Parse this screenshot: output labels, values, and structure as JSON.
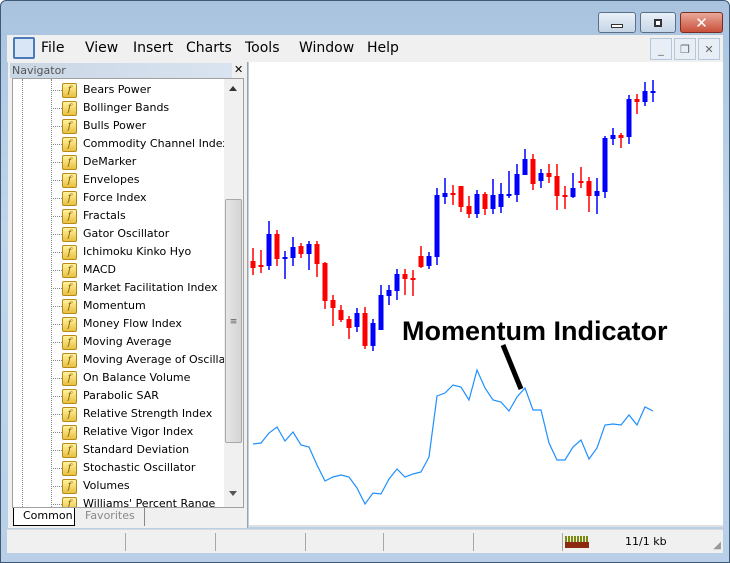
{
  "window": {
    "menu": [
      "File",
      "View",
      "Insert",
      "Charts",
      "Tools",
      "Window",
      "Help"
    ]
  },
  "navigator": {
    "title": "Navigator",
    "items": [
      "Bears Power",
      "Bollinger Bands",
      "Bulls Power",
      "Commodity Channel Index",
      "DeMarker",
      "Envelopes",
      "Force Index",
      "Fractals",
      "Gator Oscillator",
      "Ichimoku Kinko Hyo",
      "MACD",
      "Market Facilitation Index",
      "Momentum",
      "Money Flow Index",
      "Moving Average",
      "Moving Average of Oscillator",
      "On Balance Volume",
      "Parabolic SAR",
      "Relative Strength Index",
      "Relative Vigor Index",
      "Standard Deviation",
      "Stochastic Oscillator",
      "Volumes",
      "Williams' Percent Range"
    ],
    "tabs": [
      "Common",
      "Favorites"
    ],
    "active_tab": "Common",
    "icon": "indicator-function-icon"
  },
  "annotation": "Momentum Indicator",
  "status": {
    "traffic": "11/1 kb"
  },
  "colors": {
    "bull": "#0000ff",
    "bear": "#ff0000",
    "momentum": "#1e90ff"
  },
  "chart_data": {
    "type": "candlestick",
    "candles_ohlc": [
      [
        139,
        152,
        125,
        132
      ],
      [
        135,
        150,
        127,
        134
      ],
      [
        134,
        179,
        130,
        166
      ],
      [
        166,
        170,
        134,
        141
      ],
      [
        141,
        149,
        121,
        143
      ],
      [
        142,
        163,
        134,
        153
      ],
      [
        154,
        157,
        142,
        146
      ],
      [
        146,
        159,
        130,
        156
      ],
      [
        156,
        159,
        123,
        136
      ],
      [
        137,
        138,
        91,
        99
      ],
      [
        100,
        105,
        74,
        92
      ],
      [
        90,
        95,
        78,
        80
      ],
      [
        81,
        84,
        61,
        72
      ],
      [
        73,
        92,
        68,
        87
      ],
      [
        87,
        93,
        51,
        54
      ],
      [
        54,
        81,
        49,
        77
      ],
      [
        70,
        115,
        70,
        105
      ],
      [
        104,
        115,
        95,
        110
      ],
      [
        109,
        131,
        100,
        126
      ],
      [
        126,
        131,
        105,
        121
      ],
      [
        122,
        130,
        104,
        121
      ],
      [
        144,
        154,
        132,
        133
      ],
      [
        134,
        148,
        131,
        144
      ],
      [
        143,
        212,
        135,
        205
      ],
      [
        203,
        222,
        196,
        207
      ],
      [
        207,
        215,
        195,
        205
      ],
      [
        214,
        214,
        188,
        193
      ],
      [
        194,
        204,
        182,
        186
      ],
      [
        186,
        210,
        182,
        206
      ],
      [
        206,
        208,
        185,
        191
      ],
      [
        191,
        221,
        186,
        205
      ],
      [
        193,
        217,
        187,
        206
      ],
      [
        205,
        229,
        202,
        206
      ],
      [
        205,
        236,
        198,
        226
      ],
      [
        225,
        251,
        225,
        241
      ],
      [
        241,
        246,
        210,
        216
      ],
      [
        219,
        231,
        212,
        227
      ],
      [
        227,
        236,
        217,
        223
      ],
      [
        224,
        236,
        190,
        204
      ],
      [
        205,
        214,
        191,
        203
      ],
      [
        203,
        227,
        202,
        212
      ],
      [
        219,
        233,
        212,
        218
      ],
      [
        219,
        223,
        188,
        204
      ],
      [
        204,
        222,
        186,
        209
      ],
      [
        208,
        264,
        202,
        262
      ],
      [
        261,
        272,
        255,
        265
      ],
      [
        265,
        267,
        252,
        262
      ],
      [
        263,
        305,
        256,
        301
      ],
      [
        301,
        306,
        286,
        298
      ],
      [
        298,
        318,
        294,
        309
      ],
      [
        309,
        320,
        298,
        309
      ]
    ],
    "momentum": [
      100.12,
      100.14,
      100.34,
      100.46,
      100.18,
      100.36,
      100.1,
      100.06,
      99.7,
      99.38,
      99.46,
      99.5,
      99.46,
      99.24,
      98.92,
      99.14,
      99.12,
      99.42,
      99.62,
      99.46,
      99.52,
      99.56,
      99.86,
      101.08,
      101.14,
      101.3,
      101.26,
      101.0,
      101.6,
      101.24,
      101.0,
      100.96,
      100.78,
      101.06,
      101.24,
      100.8,
      100.8,
      100.14,
      99.8,
      99.8,
      100.06,
      100.2,
      99.82,
      100.04,
      100.5,
      100.52,
      100.5,
      100.7,
      100.5,
      100.86,
      100.78
    ],
    "grid": false
  }
}
